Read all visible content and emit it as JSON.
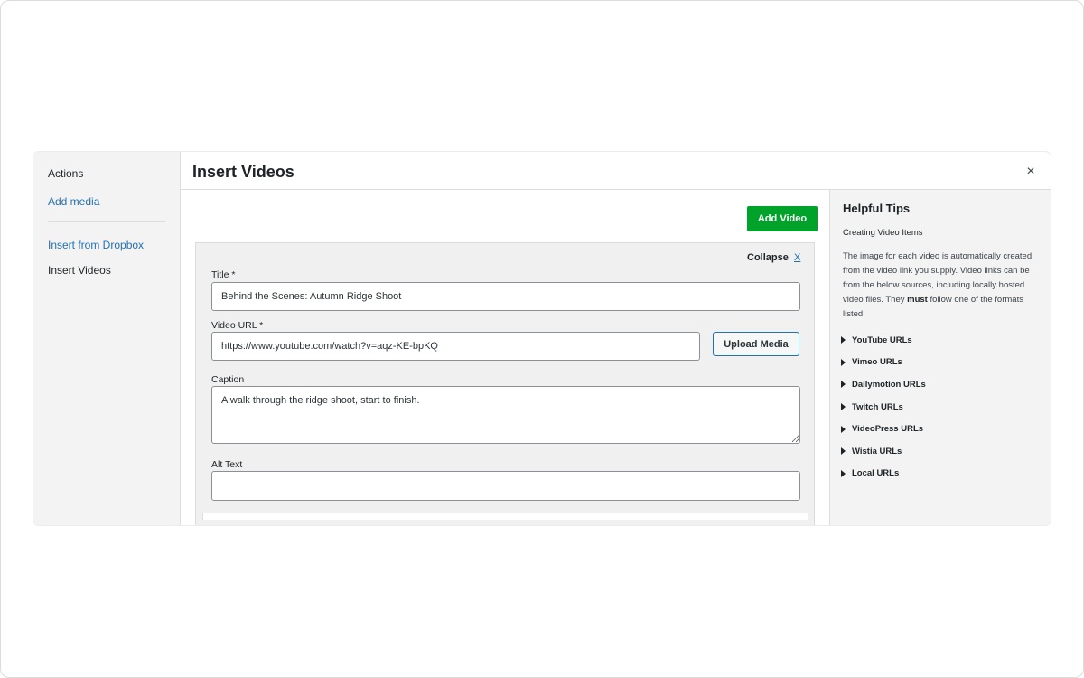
{
  "sidebar": {
    "heading": "Actions",
    "add_media": "Add media",
    "insert_dropbox": "Insert from Dropbox",
    "insert_videos": "Insert Videos"
  },
  "header": {
    "title": "Insert Videos",
    "close_symbol": "×"
  },
  "main": {
    "add_video_label": "Add Video",
    "item": {
      "collapse_label": "Collapse",
      "remove_label": "X",
      "title_label": "Title *",
      "title_value": "Behind the Scenes: Autumn Ridge Shoot",
      "url_label": "Video URL *",
      "url_value": "https://www.youtube.com/watch?v=aqz-KE-bpKQ",
      "upload_label": "Upload Media",
      "caption_label": "Caption",
      "caption_value": "A walk through the ridge shoot, start to finish.",
      "alt_label": "Alt Text",
      "alt_value": ""
    }
  },
  "tips": {
    "title": "Helpful Tips",
    "subtitle": "Creating Video Items",
    "body_before": "The image for each video is automatically created from the video link you supply. Video links can be from the below sources, including locally hosted video files. They ",
    "body_bold": "must",
    "body_after": " follow one of the formats listed:",
    "sources": [
      "YouTube URLs",
      "Vimeo URLs",
      "Dailymotion URLs",
      "Twitch URLs",
      "VideoPress URLs",
      "Wistia URLs",
      "Local URLs"
    ]
  },
  "colors": {
    "primary_button": "#00a32a",
    "link": "#2271b1",
    "panel_bg": "#f0f0f0",
    "sidebar_bg": "#f3f3f3"
  }
}
